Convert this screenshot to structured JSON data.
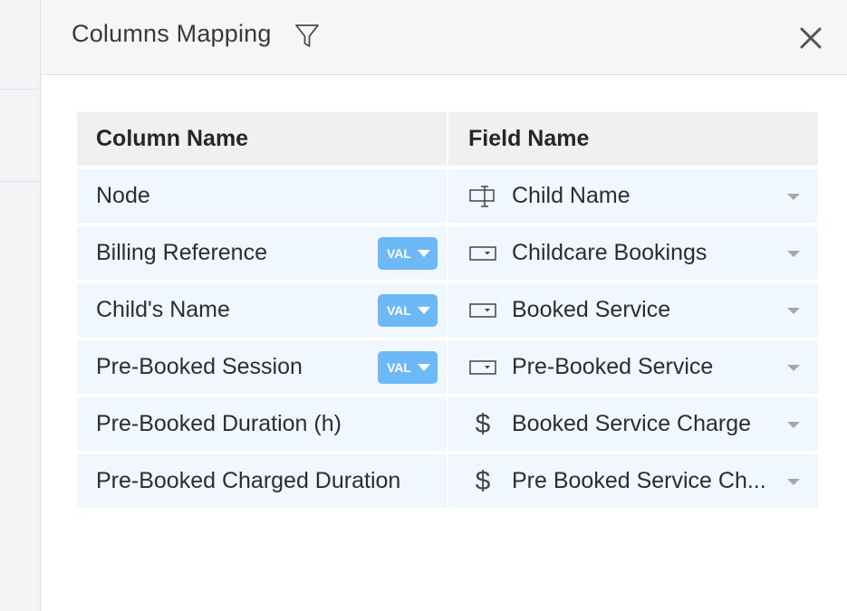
{
  "panel": {
    "title": "Columns Mapping"
  },
  "table": {
    "headers": {
      "column": "Column Name",
      "field": "Field Name"
    },
    "rows": [
      {
        "column": "Node",
        "badge": "",
        "field_icon": "text-field-icon",
        "field": "Child Name"
      },
      {
        "column": "Billing Reference",
        "badge": "VAL",
        "field_icon": "dropdown-field-icon",
        "field": "Childcare Bookings"
      },
      {
        "column": "Child's Name",
        "badge": "VAL",
        "field_icon": "dropdown-field-icon",
        "field": "Booked Service"
      },
      {
        "column": "Pre-Booked Session",
        "badge": "VAL",
        "field_icon": "dropdown-field-icon",
        "field": "Pre-Booked Service"
      },
      {
        "column": "Pre-Booked Duration (h)",
        "badge": "",
        "field_icon": "dollar-icon",
        "dollar": "$",
        "field": "Booked Service Charge"
      },
      {
        "column": "Pre-Booked Charged Duration",
        "badge": "",
        "field_icon": "dollar-icon",
        "dollar": "$",
        "field": "Pre Booked Service Ch..."
      }
    ]
  },
  "colors": {
    "row_bg": "#f0f7ff",
    "header_bg": "#f0f0f0",
    "badge_bg": "#6db8f6"
  }
}
